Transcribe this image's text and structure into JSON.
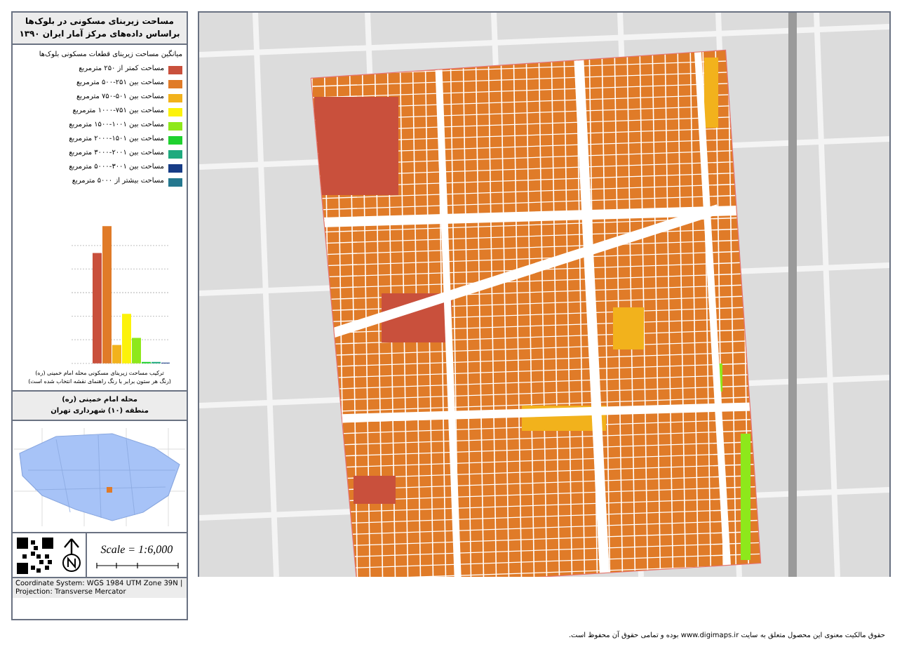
{
  "panel": {
    "title_lines": [
      "مساحت زیربنای مسکونی در بلوک‌ها",
      "براساس داده‌های مرکز آمار ایران ۱۳۹۰"
    ]
  },
  "legend": {
    "title": "میانگین مساحت زیربنای قطعات مسکونی بلوک‌ها",
    "items": [
      {
        "label": "مساحت کمتر از ۲۵۰ مترمربع",
        "color": "#c9503c"
      },
      {
        "label": "مساحت بین ۲۵۱-۵۰۰ مترمربع",
        "color": "#e07b28"
      },
      {
        "label": "مساحت بین ۵۰۱-۷۵۰ مترمربع",
        "color": "#f2b21c"
      },
      {
        "label": "مساحت بین ۷۵۱-۱۰۰۰ مترمربع",
        "color": "#fcf20a"
      },
      {
        "label": "مساحت بین ۱۰۰۱-۱۵۰۰ مترمربع",
        "color": "#8ee81b"
      },
      {
        "label": "مساحت بین ۱۵۰۱-۲۰۰۰ مترمربع",
        "color": "#1fd12f"
      },
      {
        "label": "مساحت بین ۲۰۰۱-۳۰۰۰ مترمربع",
        "color": "#1faa7e"
      },
      {
        "label": "مساحت بین ۳۰۰۱-۵۰۰۰ مترمربع",
        "color": "#173c86"
      },
      {
        "label": "مساحت بیشتر از ۵۰۰۰ مترمربع",
        "color": "#25788f"
      }
    ]
  },
  "chart": {
    "caption_lines": [
      "ترکیب مساحت زیربنای مسکونی محله امام خمینی (ره)",
      "(رنگ هر ستون برابر با رنگ راهنمای نقشه انتخاب شده است)"
    ]
  },
  "location": {
    "lines": [
      "محله امام خمینی (ره)",
      "منطقه (۱۰) شهرداری تهران"
    ]
  },
  "scale": "Scale = 1:6,000",
  "credit": "Coordinate System: WGS 1984 UTM Zone 39N | Projection: Transverse Mercator",
  "footer": "حقوق مالکیت معنوی این محصول متعلق به سایت www.digimaps.ir بوده و تمامی حقوق آن محفوظ است."
}
